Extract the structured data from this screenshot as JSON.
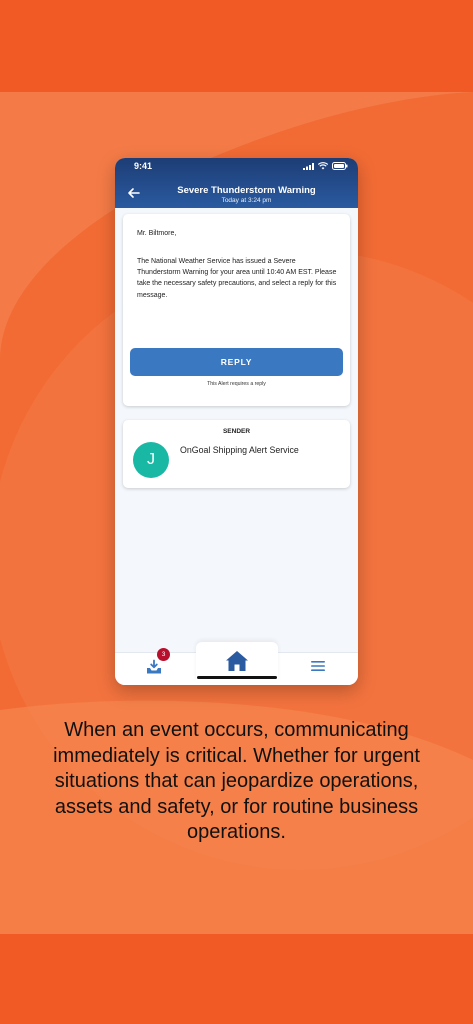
{
  "status_bar": {
    "time": "9:41"
  },
  "header": {
    "title": "Severe Thunderstorm Warning",
    "subtitle": "Today at 3:24 pm"
  },
  "message": {
    "greeting": "Mr. Biltmore,",
    "body": "The National Weather Service has issued a Severe Thunderstorm Warning for your area until 10:40 AM EST. Please take the necessary safety precautions, and select a reply for this message.",
    "reply_label": "REPLY",
    "reply_note": "This Alert requires a reply"
  },
  "sender": {
    "label": "SENDER",
    "avatar_initial": "J",
    "name": "OnGoal Shipping Alert Service"
  },
  "tabbar": {
    "inbox_badge": "3",
    "icons": [
      "inbox-download-icon",
      "home-icon",
      "menu-icon"
    ]
  },
  "caption": "When an event occurs, communicating immediately is critical. Whether for urgent situations that can jeopardize operations, assets and safety, or for routine business operations.",
  "colors": {
    "background": "#f15a24",
    "header": "#1d3d75",
    "accent": "#3a78c2",
    "avatar": "#19b8a5",
    "badge": "#b80f2c"
  }
}
